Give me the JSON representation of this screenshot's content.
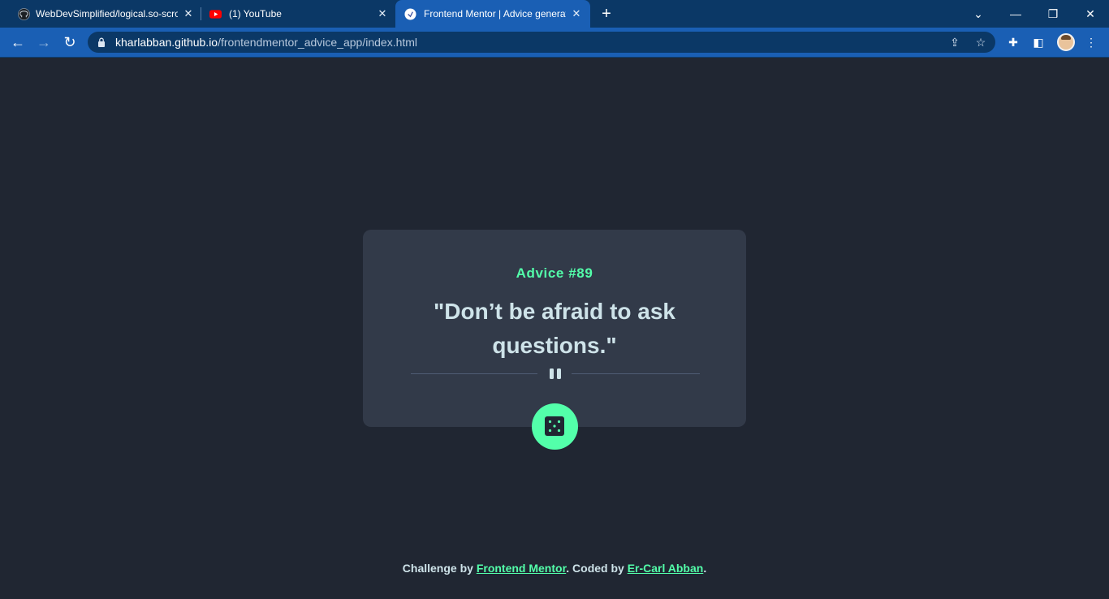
{
  "browser": {
    "tabs": [
      {
        "title": "WebDevSimplified/logical.so-scroll",
        "favicon": "github-icon",
        "active": false
      },
      {
        "title": "(1) YouTube",
        "favicon": "youtube-icon",
        "active": false
      },
      {
        "title": "Frontend Mentor | Advice generator app",
        "favicon": "frontend-mentor-icon",
        "active": true
      }
    ],
    "url_host": "kharlabban.github.io",
    "url_path": "/frontendmentor_advice_app/index.html",
    "colors": {
      "tabstrip": "#0b3866",
      "toolbar": "#1a5fb4"
    }
  },
  "advice": {
    "id_label": "Advice #89",
    "quote": "\"Don’t be afraid to ask questions.\""
  },
  "footer": {
    "prefix": "Challenge by ",
    "challenge_link": "Frontend Mentor",
    "middle": ". Coded by ",
    "author_link": "Er-Carl Abban",
    "suffix": "."
  },
  "colors": {
    "background": "#202632",
    "card": "#323a49",
    "accent": "#53ffaa",
    "text": "#cee3e9"
  }
}
